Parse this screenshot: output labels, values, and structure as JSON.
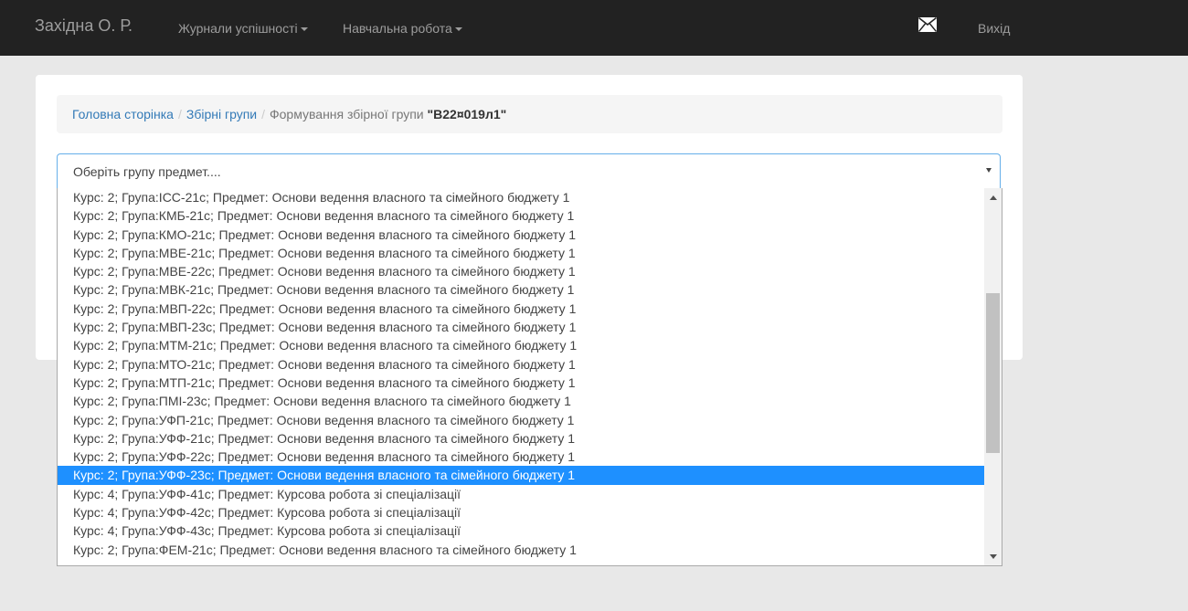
{
  "navbar": {
    "brand": "Західна О. Р.",
    "menu": [
      {
        "label": "Журнали успішності"
      },
      {
        "label": "Навчальна робота"
      }
    ],
    "mail_icon": "envelope-icon",
    "logout_label": "Вихід"
  },
  "breadcrumb": {
    "home": "Головна сторінка",
    "groups": "Збірні групи",
    "current_prefix": "Формування збірної групи ",
    "current_name": "\"В22¤019л1\""
  },
  "select": {
    "placeholder": "Оберіть групу предмет...."
  },
  "options": [
    "Курс: 2; Група:ІСС-21с; Предмет: Основи ведення власного та сімейного бюджету 1",
    "Курс: 2; Група:КМБ-21с; Предмет: Основи ведення власного та сімейного бюджету 1",
    "Курс: 2; Група:КМО-21с; Предмет: Основи ведення власного та сімейного бюджету 1",
    "Курс: 2; Група:МВЕ-21с; Предмет: Основи ведення власного та сімейного бюджету 1",
    "Курс: 2; Група:МВЕ-22с; Предмет: Основи ведення власного та сімейного бюджету 1",
    "Курс: 2; Група:МВК-21с; Предмет: Основи ведення власного та сімейного бюджету 1",
    "Курс: 2; Група:МВП-22с; Предмет: Основи ведення власного та сімейного бюджету 1",
    "Курс: 2; Група:МВП-23с; Предмет: Основи ведення власного та сімейного бюджету 1",
    "Курс: 2; Група:МТМ-21с; Предмет: Основи ведення власного та сімейного бюджету 1",
    "Курс: 2; Група:МТО-21с; Предмет: Основи ведення власного та сімейного бюджету 1",
    "Курс: 2; Група:МТП-21с; Предмет: Основи ведення власного та сімейного бюджету 1",
    "Курс: 2; Група:ПМІ-23с; Предмет: Основи ведення власного та сімейного бюджету 1",
    "Курс: 2; Група:УФП-21с; Предмет: Основи ведення власного та сімейного бюджету 1",
    "Курс: 2; Група:УФФ-21с; Предмет: Основи ведення власного та сімейного бюджету 1",
    "Курс: 2; Група:УФФ-22с; Предмет: Основи ведення власного та сімейного бюджету 1",
    "Курс: 2; Група:УФФ-23с; Предмет: Основи ведення власного та сімейного бюджету 1",
    "Курс: 4; Група:УФФ-41с; Предмет: Курсова робота зі спеціалізації",
    "Курс: 4; Група:УФФ-42с; Предмет: Курсова робота зі спеціалізації",
    "Курс: 4; Група:УФФ-43с; Предмет: Курсова робота зі спеціалізації",
    "Курс: 2; Група:ФЕМ-21с; Предмет: Основи ведення власного та сімейного бюджету 1"
  ],
  "selected_index": 15,
  "colors": {
    "navbar_bg": "#222222",
    "link": "#337ab7",
    "highlight": "#1e90ff"
  }
}
